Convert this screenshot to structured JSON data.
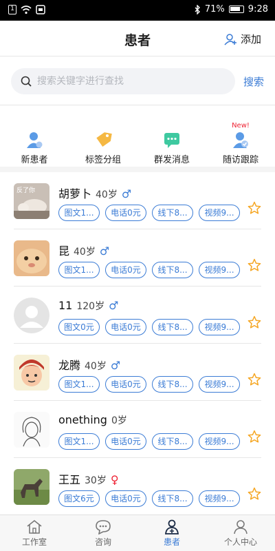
{
  "status_bar": {
    "battery": "71%",
    "time": "9:28",
    "notif_box": "1"
  },
  "header": {
    "title": "患者",
    "add_label": "添加"
  },
  "search": {
    "placeholder": "搜索关键字进行查找",
    "button": "搜索"
  },
  "quick_actions": [
    {
      "label": "新患者",
      "icon": "new-patient-icon",
      "badge": ""
    },
    {
      "label": "标签分组",
      "icon": "tag-icon",
      "badge": ""
    },
    {
      "label": "群发消息",
      "icon": "message-icon",
      "badge": ""
    },
    {
      "label": "随访跟踪",
      "icon": "follow-up-icon",
      "badge": "New!"
    }
  ],
  "patients": [
    {
      "name": "胡萝卜",
      "age": "40岁",
      "gender": "♂",
      "tags": [
        "图文1...",
        "电话0元",
        "线下8...",
        "视频9..."
      ],
      "avatar_text": "反了你"
    },
    {
      "name": "昆",
      "age": "40岁",
      "gender": "♂",
      "tags": [
        "图文1...",
        "电话0元",
        "线下8...",
        "视频9..."
      ]
    },
    {
      "name": "11",
      "age": "120岁",
      "gender": "♂",
      "tags": [
        "图文0元",
        "电话0元",
        "线下8...",
        "视频9..."
      ]
    },
    {
      "name": "龙腾",
      "age": "40岁",
      "gender": "♂",
      "tags": [
        "图文1...",
        "电话0元",
        "线下8...",
        "视频9..."
      ]
    },
    {
      "name": "onething",
      "age": "0岁",
      "gender": "",
      "tags": [
        "图文1...",
        "电话0元",
        "线下8...",
        "视频9..."
      ]
    },
    {
      "name": "王五",
      "age": "30岁",
      "gender": "♀",
      "tags": [
        "图文6元",
        "电话0元",
        "线下8...",
        "视频9..."
      ]
    }
  ],
  "tabs": [
    {
      "label": "工作室",
      "icon": "home-icon"
    },
    {
      "label": "咨询",
      "icon": "chat-icon"
    },
    {
      "label": "患者",
      "icon": "patient-icon",
      "active": true
    },
    {
      "label": "个人中心",
      "icon": "profile-icon"
    }
  ],
  "colors": {
    "accent": "#3a7bd5",
    "star": "#f5a623",
    "female": "#e23"
  }
}
